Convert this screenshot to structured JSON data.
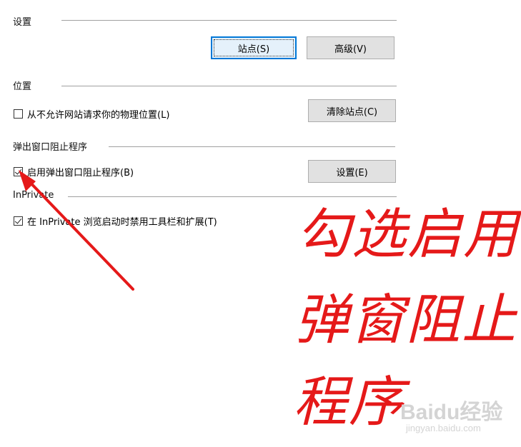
{
  "sections": {
    "settings": {
      "title": "设置",
      "site_button": "站点(S)",
      "advanced_button": "高级(V)"
    },
    "location": {
      "title": "位置",
      "never_allow_label": "从不允许网站请求你的物理位置(L)",
      "never_allow_checked": false,
      "clear_sites_button": "清除站点(C)"
    },
    "popup": {
      "title": "弹出窗口阻止程序",
      "enable_label": "启用弹出窗口阻止程序(B)",
      "enable_checked": true,
      "settings_button": "设置(E)"
    },
    "inprivate": {
      "title": "InPrivate",
      "disable_toolbars_label": "在 InPrivate 浏览启动时禁用工具栏和扩展(T)",
      "disable_toolbars_checked": true
    }
  },
  "annotation": {
    "line1": "勾选启用",
    "line2": "弹窗阻止",
    "line3": "程序",
    "color": "#e51919"
  },
  "watermark": {
    "brand": "Baidu经验",
    "url": "jingyan.baidu.com"
  }
}
